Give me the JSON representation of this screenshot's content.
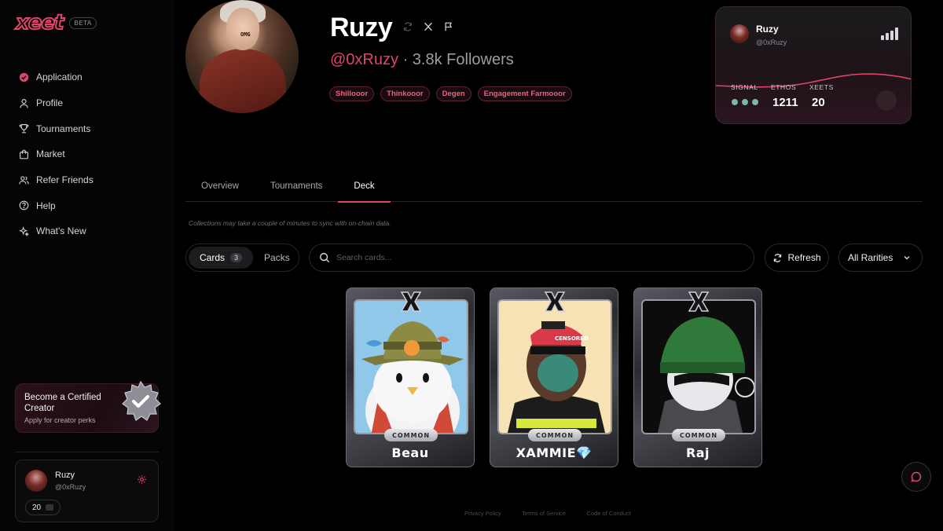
{
  "app": {
    "logo_text": "xeet",
    "beta_label": "BETA"
  },
  "sidebar": {
    "items": [
      {
        "label": "Application",
        "icon": "check-badge-icon"
      },
      {
        "label": "Profile",
        "icon": "user-icon"
      },
      {
        "label": "Tournaments",
        "icon": "trophy-icon"
      },
      {
        "label": "Market",
        "icon": "shopping-bag-icon"
      },
      {
        "label": "Refer Friends",
        "icon": "users-icon"
      },
      {
        "label": "Help",
        "icon": "help-circle-icon"
      },
      {
        "label": "What's New",
        "icon": "sparkles-icon"
      }
    ],
    "creator": {
      "title": "Become a Certified Creator",
      "subtitle": "Apply for creator perks"
    },
    "user": {
      "name": "Ruzy",
      "handle": "@0xRuzy",
      "count": "20"
    }
  },
  "profile": {
    "avatar_caption": "OMG",
    "name": "Ruzy",
    "handle": "@0xRuzy",
    "separator": "·",
    "followers": "3.8k Followers",
    "tags": [
      "Shillooor",
      "Thinkooor",
      "Degen",
      "Engagement Farmooor"
    ]
  },
  "stats": {
    "name": "Ruzy",
    "handle": "@0xRuzy",
    "signal_label": "SIGNAL",
    "ethos_label": "ETHOS",
    "xeets_label": "XEETS",
    "signal_dots": 3,
    "ethos": "1211",
    "xeets": "20",
    "wave_color": "#e0446a"
  },
  "tabs": [
    {
      "label": "Overview",
      "active": false
    },
    {
      "label": "Tournaments",
      "active": false
    },
    {
      "label": "Deck",
      "active": true
    }
  ],
  "deck": {
    "notice": "Collections may take a couple of minutes to sync with on-chain data.",
    "segments": {
      "cards_label": "Cards",
      "cards_count": "3",
      "packs_label": "Packs"
    },
    "search_placeholder": "Search cards...",
    "refresh_label": "Refresh",
    "rarity_filter": "All Rarities",
    "cards": [
      {
        "name": "Beau",
        "rarity": "COMMON"
      },
      {
        "name": "XAMMIE💎",
        "rarity": "COMMON",
        "art_caption": "CENSORED"
      },
      {
        "name": "Raj",
        "rarity": "COMMON"
      }
    ]
  },
  "footer": {
    "links": [
      "Privacy Policy",
      "Terms of Service",
      "Code of Conduct"
    ],
    "separator": "·"
  },
  "colors": {
    "accent": "#e0446a",
    "background": "#000000"
  }
}
